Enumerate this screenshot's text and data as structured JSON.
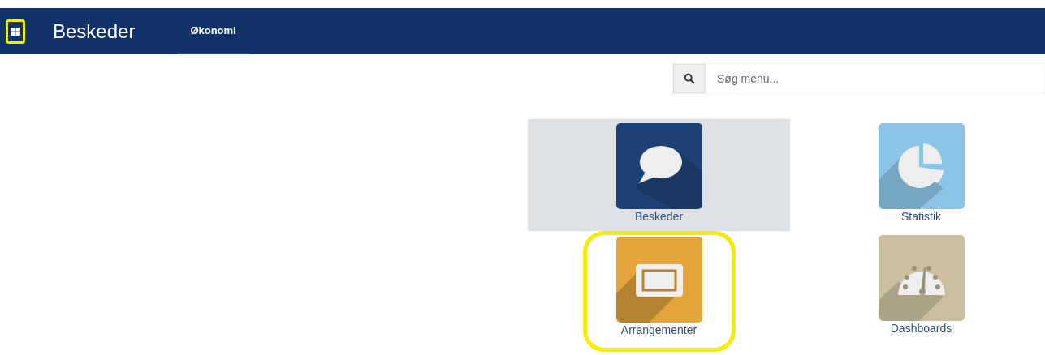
{
  "navbar": {
    "menu_highlighted": true,
    "brand": "Beskeder",
    "menu_items": [
      {
        "label": "Økonomi",
        "selected": true
      }
    ]
  },
  "search": {
    "placeholder": "Søg menu..."
  },
  "apps": [
    {
      "name": "Beskeder",
      "kind": "chat",
      "color": "#1d4174",
      "selected": true,
      "highlighted": false
    },
    {
      "name": "Statistik",
      "kind": "chart",
      "color": "#8cc4e6",
      "selected": false,
      "highlighted": false
    },
    {
      "name": "Arrangementer",
      "kind": "ticket",
      "color": "#e3a43c",
      "selected": false,
      "highlighted": true
    },
    {
      "name": "Dashboards",
      "kind": "gauge",
      "color": "#cbbf9f",
      "selected": false,
      "highlighted": false
    }
  ]
}
